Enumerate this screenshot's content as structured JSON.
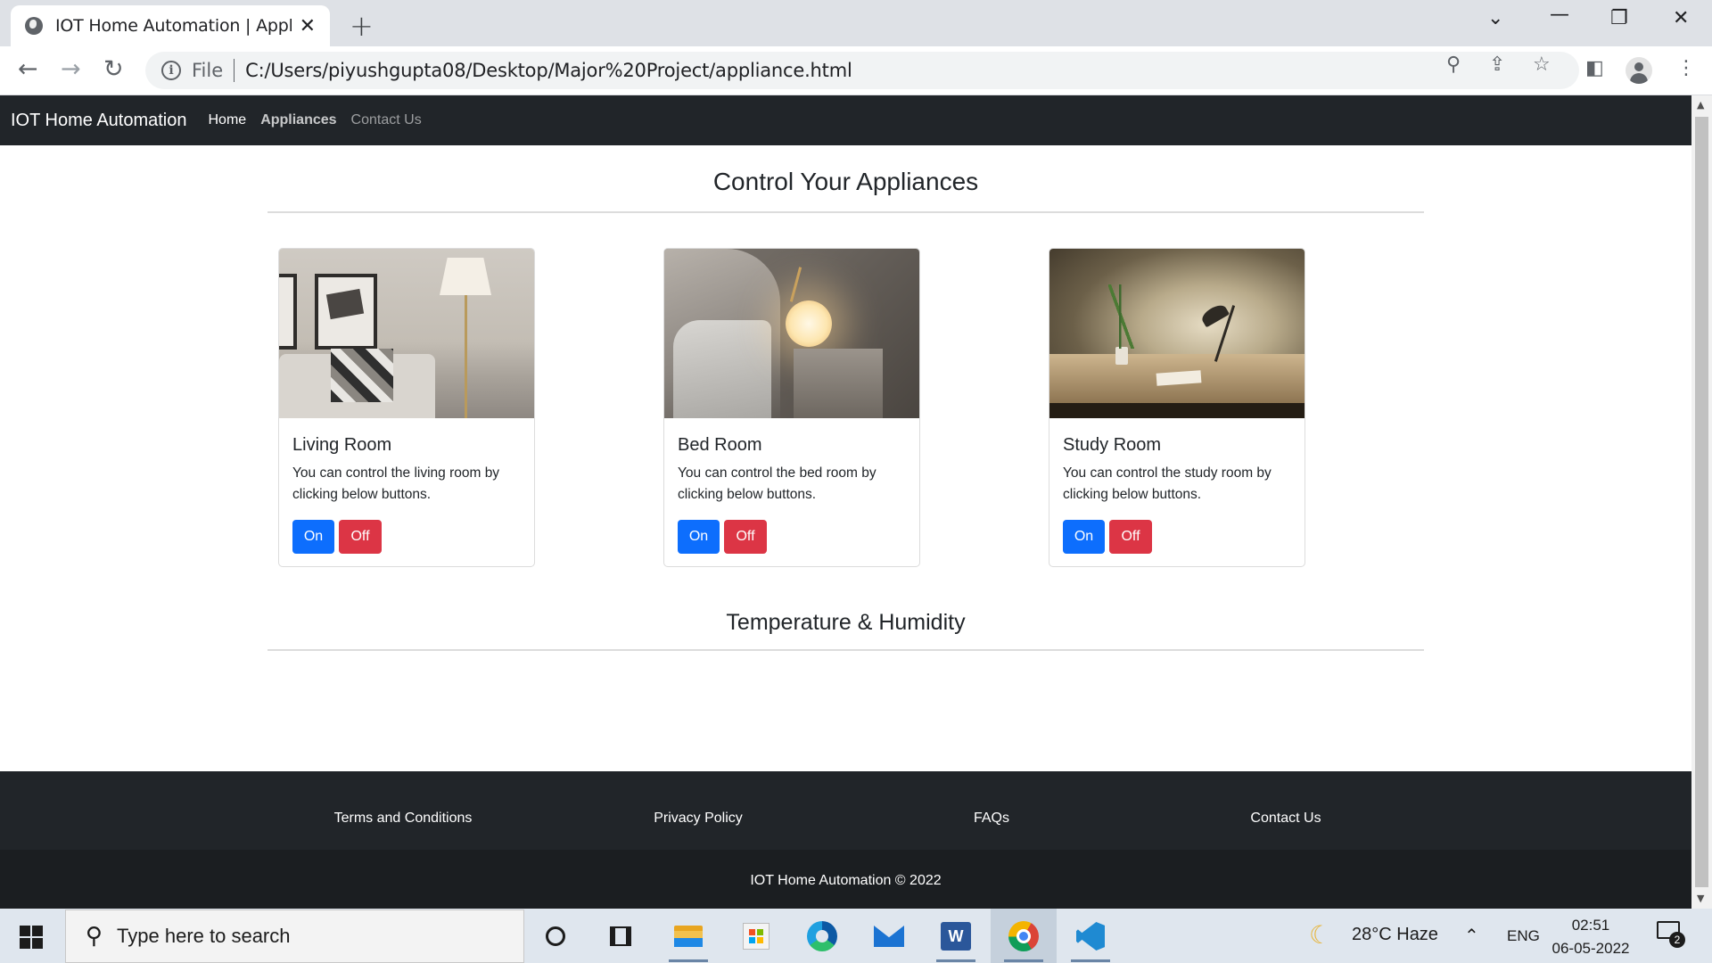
{
  "browser": {
    "tab_title": "IOT Home Automation | Applianc",
    "close_glyph": "✕",
    "newtab_glyph": "+",
    "file_label": "File",
    "url": "C:/Users/piyushgupta08/Desktop/Major%20Project/appliance.html",
    "icons": [
      "back-icon",
      "forward-icon",
      "reload-icon",
      "info-icon",
      "zoom-icon",
      "share-icon",
      "star-icon",
      "sidepanel-icon",
      "profile-icon",
      "menu-icon"
    ]
  },
  "site": {
    "brand": "IOT Home Automation",
    "nav": {
      "home": "Home",
      "appliances": "Appliances",
      "contact": "Contact Us"
    },
    "appliances_title": "Control Your Appliances",
    "temperature_title": "Temperature & Humidity",
    "cards": [
      {
        "title": "Living Room",
        "text": "You can control the living room by clicking below buttons.",
        "on": "On",
        "off": "Off"
      },
      {
        "title": "Bed Room",
        "text": "You can control the bed room by clicking below buttons.",
        "on": "On",
        "off": "Off"
      },
      {
        "title": "Study Room",
        "text": "You can control the study room by clicking below buttons.",
        "on": "On",
        "off": "Off"
      }
    ],
    "footer": {
      "links": [
        "Terms and Conditions",
        "Privacy Policy",
        "FAQs",
        "Contact Us"
      ],
      "copyright": "IOT Home Automation © 2022"
    },
    "colors": {
      "navbar": "#212529",
      "primary": "#0d6efd",
      "danger": "#dc3545"
    }
  },
  "taskbar": {
    "search_placeholder": "Type here to search",
    "weather": "28°C  Haze",
    "lang": "ENG",
    "time": "02:51",
    "date": "06-05-2022",
    "notification_count": "2",
    "apps": [
      "cortana-icon",
      "task-view-icon",
      "file-explorer-icon",
      "store-icon",
      "edge-icon",
      "mail-icon",
      "word-icon",
      "chrome-icon",
      "vscode-icon"
    ]
  }
}
